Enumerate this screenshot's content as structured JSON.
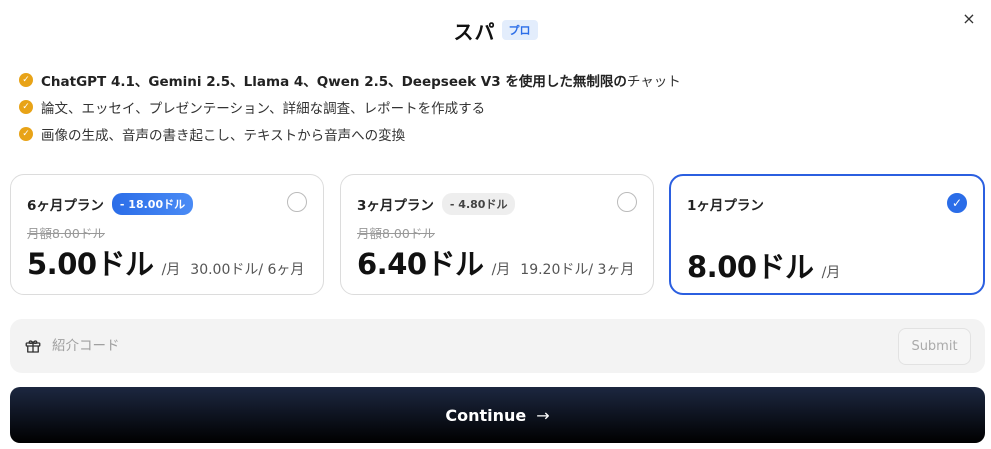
{
  "header": {
    "title": "スパ",
    "badge": "プロ",
    "close_icon": "×"
  },
  "features": [
    {
      "icon": "check-icon",
      "bold": "ChatGPT 4.1、Gemini 2.5、Llama 4、Qwen 2.5、Deepseek V3 を使用した無制限の",
      "text": "チャット"
    },
    {
      "icon": "check-icon",
      "bold": "",
      "text": "論文、エッセイ、プレゼンテーション、詳細な調査、レポートを作成する"
    },
    {
      "icon": "check-icon",
      "bold": "",
      "text": "画像の生成、音声の書き起こし、テキストから音声への変換"
    }
  ],
  "plans": [
    {
      "name": "6ヶ月プラン",
      "discount": "- 18.00ドル",
      "old_price": "月額8.00ドル",
      "price": "5.00ドル",
      "per": "/月",
      "total": "30.00ドル/ 6ヶ月",
      "selected": false
    },
    {
      "name": "3ヶ月プラン",
      "discount": "- 4.80ドル",
      "old_price": "月額8.00ドル",
      "price": "6.40ドル",
      "per": "/月",
      "total": "19.20ドル/ 3ヶ月",
      "selected": false
    },
    {
      "name": "1ヶ月プラン",
      "discount": "",
      "old_price": "",
      "price": "8.00ドル",
      "per": "/月",
      "total": "",
      "selected": true
    }
  ],
  "referral": {
    "placeholder": "紹介コード",
    "submit_label": "Submit",
    "icon": "gift-icon"
  },
  "continue": {
    "label": "Continue",
    "arrow": "→"
  },
  "colors": {
    "accent": "#2b6de8",
    "check": "#e8a317",
    "button_bg": "#000000"
  }
}
